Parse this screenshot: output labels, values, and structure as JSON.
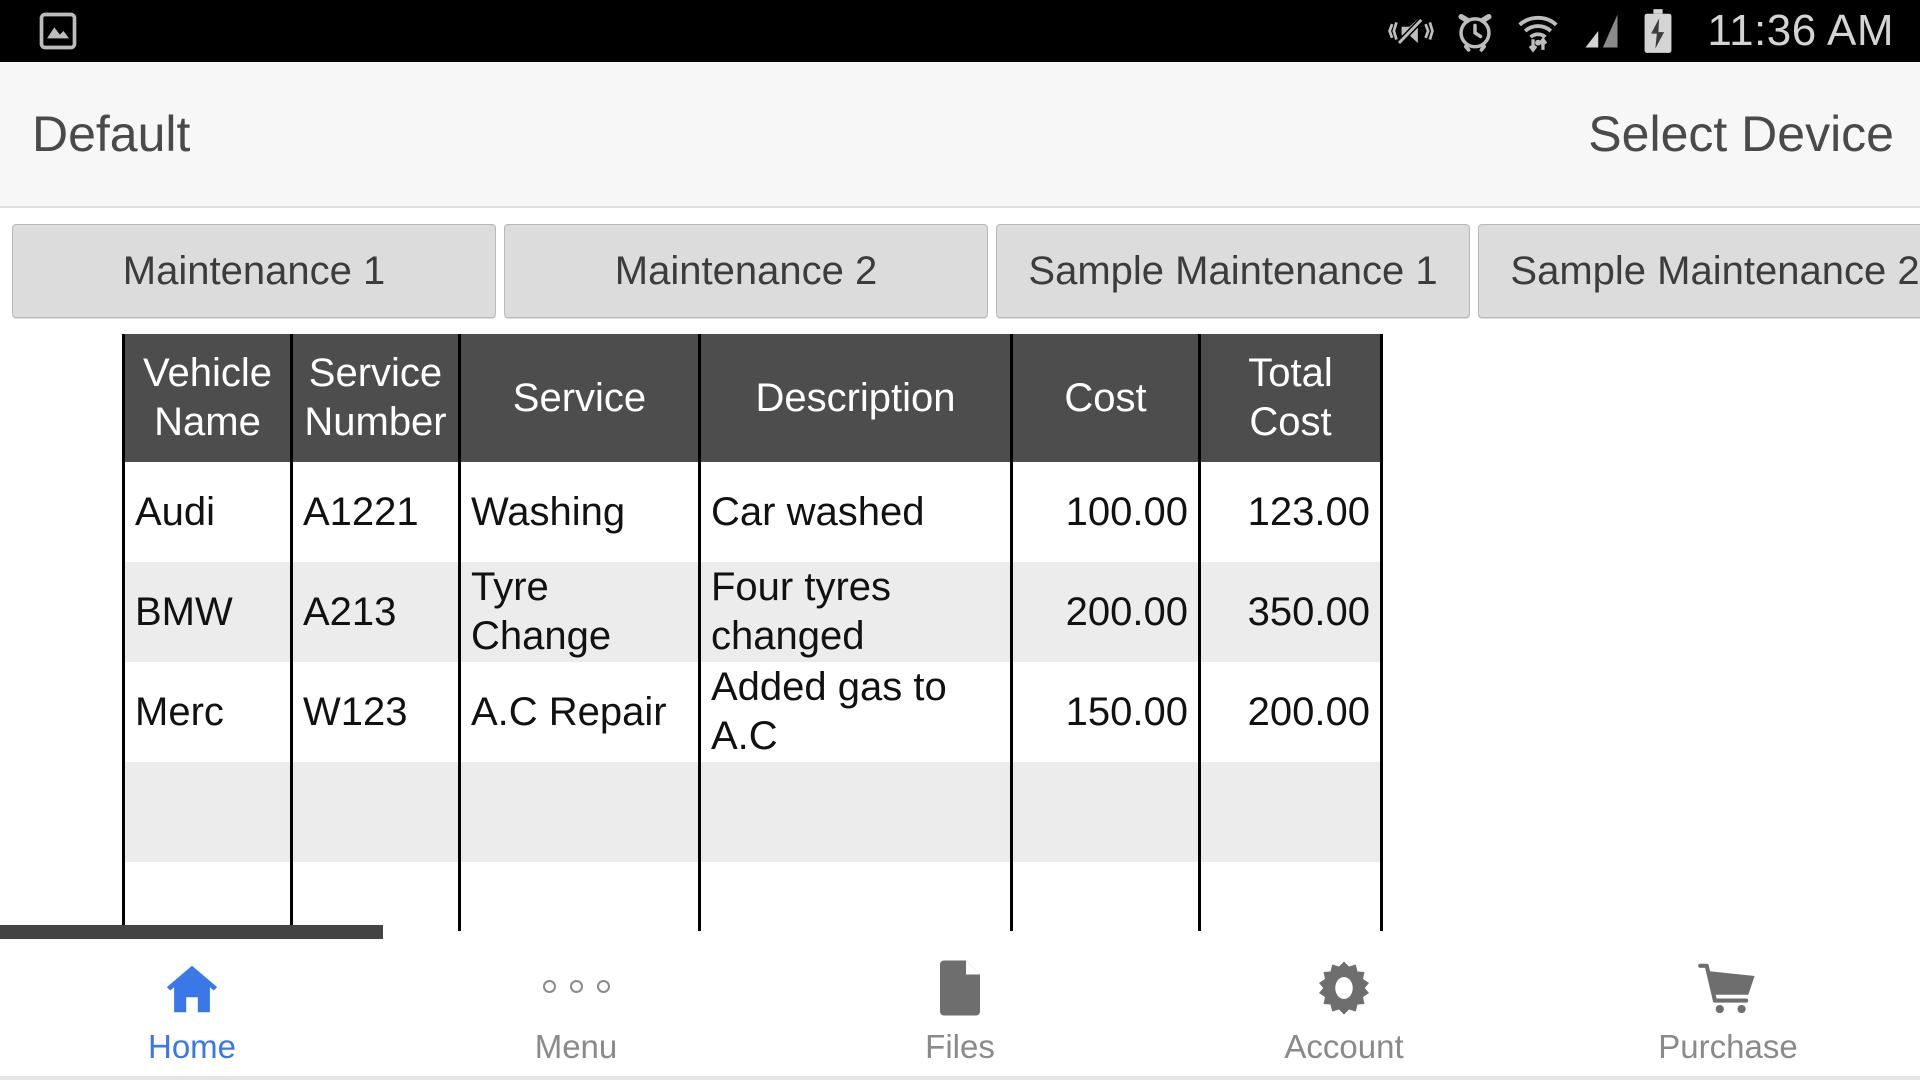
{
  "statusbar": {
    "time": "11:36 AM",
    "icons": [
      "image-icon",
      "vibrate-mute-icon",
      "alarm-clock-icon",
      "wifi-data-transfer-icon",
      "cellular-signal-icon",
      "battery-charging-icon"
    ]
  },
  "header": {
    "title": "Default",
    "action_label": "Select Device"
  },
  "tabs": [
    {
      "label": "Maintenance 1"
    },
    {
      "label": "Maintenance 2"
    },
    {
      "label": "Sample Maintenance 1"
    },
    {
      "label": "Sample Maintenance 2"
    }
  ],
  "table": {
    "columns": [
      {
        "line1": "Vehicle",
        "line2": "Name"
      },
      {
        "line1": "Service",
        "line2": "Number"
      },
      {
        "line1": "Service",
        "line2": ""
      },
      {
        "line1": "Description",
        "line2": ""
      },
      {
        "line1": "Cost",
        "line2": ""
      },
      {
        "line1": "Total Cost",
        "line2": ""
      }
    ],
    "rows": [
      {
        "vehicle_name": "Audi",
        "service_number": "A1221",
        "service": "Washing",
        "description": "Car washed",
        "cost": "100.00",
        "total_cost": "123.00"
      },
      {
        "vehicle_name": "BMW",
        "service_number": "A213",
        "service": "Tyre Change",
        "description": "Four tyres changed",
        "cost": "200.00",
        "total_cost": "350.00"
      },
      {
        "vehicle_name": "Merc",
        "service_number": "W123",
        "service": "A.C Repair",
        "description": "Added gas to A.C",
        "cost": "150.00",
        "total_cost": "200.00"
      },
      {
        "vehicle_name": "",
        "service_number": "",
        "service": "",
        "description": "",
        "cost": "",
        "total_cost": ""
      },
      {
        "vehicle_name": "",
        "service_number": "",
        "service": "",
        "description": "",
        "cost": "",
        "total_cost": ""
      },
      {
        "vehicle_name": "",
        "service_number": "",
        "service": "",
        "description": "",
        "cost": "",
        "total_cost": ""
      }
    ]
  },
  "bottom_nav": {
    "items": [
      {
        "label": "Home",
        "icon": "home-icon",
        "active": true
      },
      {
        "label": "Menu",
        "icon": "more-dots-icon",
        "active": false
      },
      {
        "label": "Files",
        "icon": "document-icon",
        "active": false
      },
      {
        "label": "Account",
        "icon": "gear-icon",
        "active": false
      },
      {
        "label": "Purchase",
        "icon": "cart-icon",
        "active": false
      }
    ]
  },
  "colors": {
    "accent": "#3b78e7",
    "table_header_bg": "#4d4d4d",
    "row_alt_bg": "#ececec",
    "tab_bg": "#dcdcdc",
    "header_bg": "#f7f7f7",
    "nav_inactive": "#8a8a8a"
  }
}
